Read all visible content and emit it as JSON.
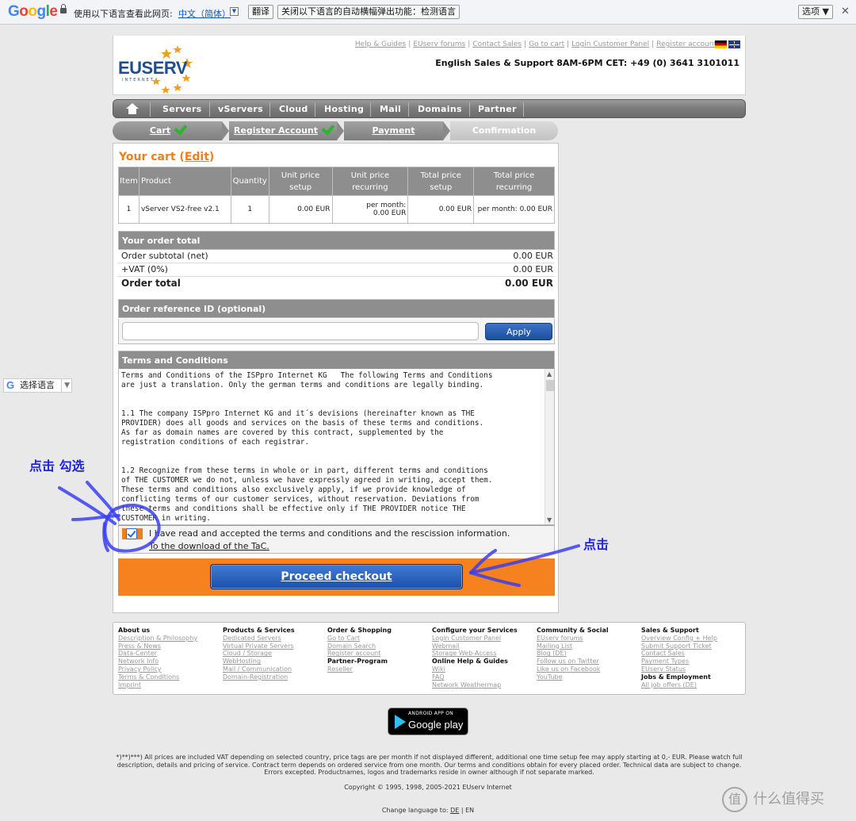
{
  "gtranslate": {
    "logo_parts": [
      "G",
      "o",
      "o",
      "g",
      "l",
      "e"
    ],
    "prompt": "使用以下语言查看此网页:",
    "language": "中文（简体）",
    "translate_btn": "翻译",
    "disable_btn": "关闭以下语言的自动横幅弹出功能：检测语言",
    "options_btn": "选项 ▼",
    "close": "✕"
  },
  "header": {
    "logo_text": "EUSERV",
    "logo_sub": "INTERNET",
    "links": [
      "Help & Guides",
      "EUserv forums",
      "Contact Sales",
      "Go to cart",
      "Login Customer Panel",
      "Register account"
    ],
    "support": "English Sales & Support 8AM-6PM CET: +49 (0) 3641 3101011"
  },
  "nav": [
    "Servers",
    "vServers",
    "Cloud",
    "Hosting",
    "Mail",
    "Domains",
    "Partner"
  ],
  "steps": [
    "Cart",
    "Register Account",
    "Payment",
    "Confirmation"
  ],
  "cart": {
    "title": "Your cart (",
    "edit": "Edit",
    "title_end": ")",
    "headers": [
      "Item",
      "Product",
      "Quantity",
      "Unit price setup",
      "Unit price recurring",
      "Total price setup",
      "Total price recurring"
    ],
    "row": {
      "item": "1",
      "product": "vServer VS2-free v2.1",
      "quantity": "1",
      "unit_setup": "0.00 EUR",
      "unit_rec_1": "per month:",
      "unit_rec_2": "0.00 EUR",
      "total_setup": "0.00 EUR",
      "total_rec": "per month: 0.00 EUR"
    }
  },
  "totals": {
    "header": "Your order total",
    "subtotal_label": "Order subtotal (net)",
    "subtotal": "0.00 EUR",
    "vat_label": "+VAT (0%)",
    "vat": "0.00 EUR",
    "total_label": "Order total",
    "total": "0.00 EUR"
  },
  "reference": {
    "header": "Order reference ID (optional)",
    "value": "",
    "apply": "Apply"
  },
  "terms": {
    "header": "Terms and Conditions",
    "text": "Terms and Conditions of the ISPpro Internet KG   The following Terms and Conditions\nare just a translation. Only the german terms and conditions are legally binding.\n\n\n1.1 The company ISPpro Internet KG and it´s devisions (hereinafter known as THE\nPROVIDER) does all goods and services on the basis of these terms and conditions.\nAs far as domain names are covered by this contract, supplemented by the\nregistration conditions of each registrar.\n\n\n1.2 Recognize from these terms in whole or in part, different terms and conditions\nof THE CUSTOMER we do not, unless we have expressly agreed in writing, accept them.\nThese terms and conditions also exclusively apply, if we provide knowledge of\nconflicting terms of our customer services, without reservation. Deviations from\nthese terms and conditions shall be effective only if THE PROVIDER notice THE\nCUSTOMER in writing.",
    "accept": "I have read and accepted the terms and conditions and the rescission information.",
    "download": "To the download of the TaC."
  },
  "checkout": "Proceed checkout",
  "footer": [
    {
      "title": "About us",
      "links": [
        "Description & Philosophy",
        "Press & News",
        "Data-Center",
        "Network Info",
        "Privacy Policy",
        "Terms & Conditions",
        "Imprint"
      ]
    },
    {
      "title": "Products & Services",
      "links": [
        "Dedicated Servers",
        "Virtual Private Servers",
        "Cloud / Storage",
        "WebHosting",
        "Mail / Communication",
        "Domain-Registration"
      ]
    },
    {
      "title": "Order & Shopping",
      "links": [
        "Go to Cart",
        "Domain Search",
        "Register account"
      ],
      "bold": "Partner-Program",
      "links2": [
        "Reseller"
      ]
    },
    {
      "title": "Configure your Services",
      "links": [
        "Login Customer Panel",
        "Webmail",
        "Storage Web-Access"
      ],
      "bold": "Online Help & Guides",
      "links2": [
        "Wiki",
        "FAQ",
        "Network Weathermap"
      ]
    },
    {
      "title": "Community & Social",
      "links": [
        "EUserv forums",
        "Mailing List",
        "Blog (DE)",
        "Follow us on Twitter",
        "Like us on Facebook",
        "YouTube"
      ]
    },
    {
      "title": "Sales & Support",
      "links": [
        "Overview Config + Help",
        "Submit Support Ticket",
        "Contact Sales",
        "Payment Types",
        "EUserv Status"
      ],
      "bold": "Jobs & Employment",
      "links2": [
        "All job offers (DE)"
      ]
    }
  ],
  "gplay": {
    "line1": "ANDROID APP ON",
    "line2": "Google play"
  },
  "disclaimer": "*)**)***) All prices are included VAT depending on selected country, price tags are per month if not displayed different, additional one time setup fee may apply starting at 0,- EUR. Please watch full description, details and pricing of service. Contract term depends on ordered service from one month. Our terms and conditions obtain for every placed order. Technical data are subject to change. Errors excepted. Productnames, logos and trademarks reside in owner although if not separate marked.",
  "copyright": "Copyright © 1995, 1998, 2005-2021 EUserv Internet",
  "change_lang": {
    "label": "Change language to:",
    "de": "DE",
    "sep": "|",
    "en": "EN"
  },
  "gselect": {
    "g": "G",
    "label": "选择语言",
    "arrow": "▼"
  },
  "annotations": {
    "left": "点击  勾选",
    "right": "点击"
  },
  "watermark": {
    "icon": "值",
    "text": "什么值得买"
  }
}
